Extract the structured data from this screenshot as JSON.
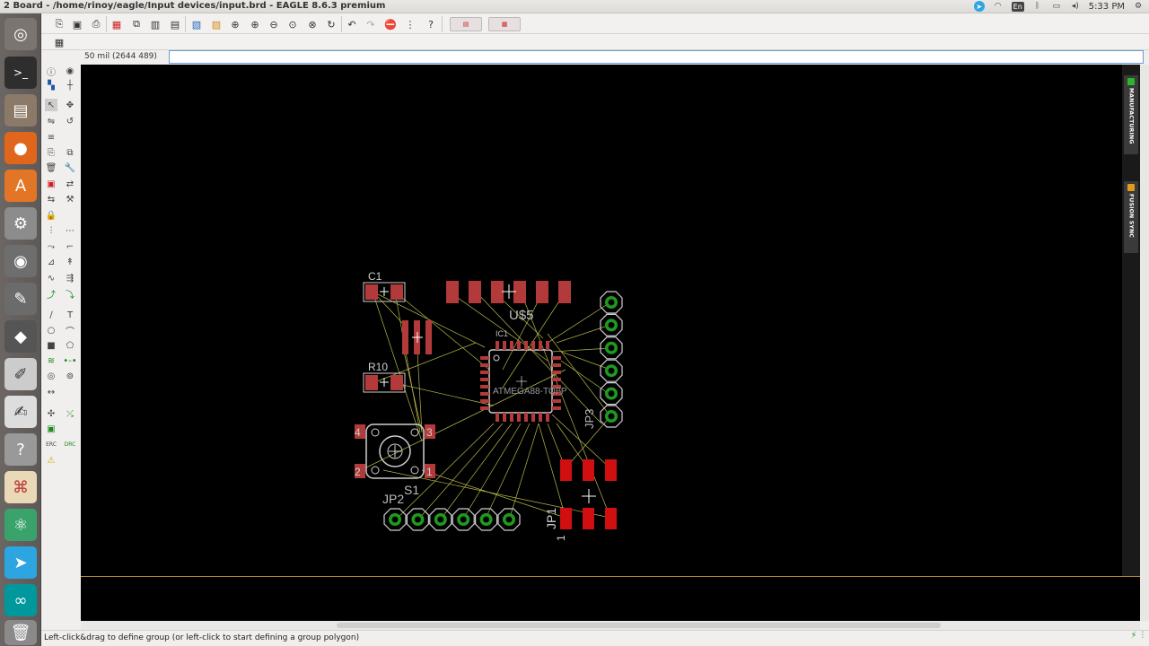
{
  "window": {
    "title": "2 Board - /home/rinoy/eagle/Input devices/input.brd - EAGLE 8.6.3 premium",
    "clock": "5:33 PM",
    "keyboard_layout": "En"
  },
  "command_bar": {
    "coords": "50 mil (2644 489)",
    "input_value": ""
  },
  "status": {
    "message": "Left-click&drag to define group (or left-click to start defining a group polygon)"
  },
  "side_tabs": {
    "manufacturing": "MANUFACTURING",
    "fusion_sync": "FUSION SYNC"
  },
  "board": {
    "labels": {
      "c1": "C1",
      "u5": "U$5",
      "ic1": "IC1",
      "r10": "R10",
      "atmega": "ATMEGA88-TQFP",
      "jp3": "JP3",
      "jp2": "JP2",
      "s1": "S1",
      "jp1": "JP1",
      "pin1": "1",
      "s1_p4": "4",
      "s1_p3": "3",
      "s1_p2": "2",
      "s1_p1": "1"
    }
  },
  "colors": {
    "pad": "#d01010",
    "pad_muted": "#b33a3a",
    "airwire": "#b8b84a",
    "silk": "#cfcfcf",
    "via_ring": "#1f9a1f",
    "canvas": "#000000"
  }
}
